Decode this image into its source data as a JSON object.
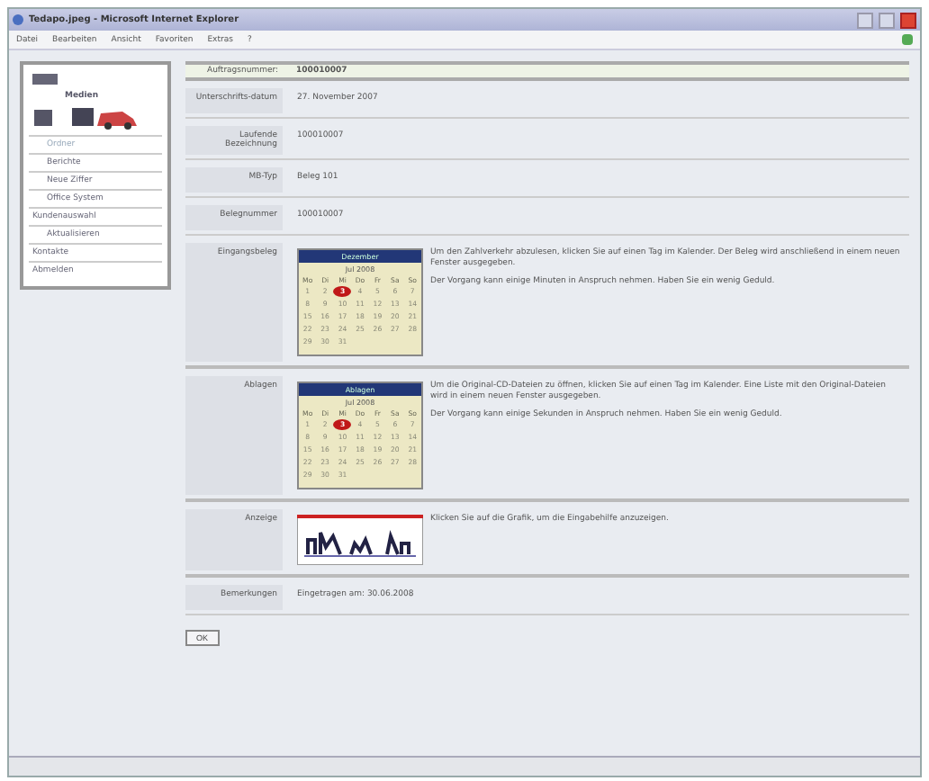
{
  "window": {
    "title": "Tedapo.jpeg - Microsoft Internet Explorer"
  },
  "menu": [
    "Datei",
    "Bearbeiten",
    "Ansicht",
    "Favoriten",
    "Extras",
    "?"
  ],
  "sidebar": {
    "title": "Medien",
    "items": [
      {
        "label": "Ordner",
        "selected": true
      },
      {
        "label": "Berichte",
        "selected": false
      },
      {
        "label": "Neue Ziffer",
        "selected": false
      },
      {
        "label": "Office System",
        "selected": false
      },
      {
        "label": "Kundenauswahl",
        "selected": false,
        "children": [
          {
            "label": "Aktualisieren",
            "selected": false
          }
        ]
      },
      {
        "label": "Kontakte",
        "selected": false
      },
      {
        "label": "Abmelden",
        "selected": false
      }
    ]
  },
  "header": {
    "label": "Auftragsnummer:",
    "value": "100010007"
  },
  "fields": [
    {
      "label": "Unterschrifts-datum",
      "value": "27. November 2007"
    },
    {
      "label": "Laufende Bezeichnung",
      "value": "100010007"
    },
    {
      "label": "MB-Typ",
      "value": "Beleg 101"
    },
    {
      "label": "Belegnummer",
      "value": "100010007"
    }
  ],
  "sections": [
    {
      "label": "Eingangsbeleg",
      "kind": "calendar",
      "calendar": {
        "title": "Dezember",
        "month": "Jul 2008",
        "weekdays": [
          "Mo",
          "Di",
          "Mi",
          "Do",
          "Fr",
          "Sa",
          "So"
        ],
        "days": [
          {
            "d": "1",
            "selected": false
          },
          {
            "d": "2",
            "selected": false
          },
          {
            "d": "3",
            "selected": true
          },
          {
            "d": "4",
            "selected": false
          },
          {
            "d": "5",
            "selected": false
          },
          {
            "d": "6",
            "selected": false
          },
          {
            "d": "7",
            "selected": false
          },
          {
            "d": "8",
            "selected": false
          },
          {
            "d": "9",
            "selected": false
          },
          {
            "d": "10",
            "selected": false
          },
          {
            "d": "11",
            "selected": false
          },
          {
            "d": "12",
            "selected": false
          },
          {
            "d": "13",
            "selected": false
          },
          {
            "d": "14",
            "selected": false
          },
          {
            "d": "15",
            "selected": false
          },
          {
            "d": "16",
            "selected": false
          },
          {
            "d": "17",
            "selected": false
          },
          {
            "d": "18",
            "selected": false
          },
          {
            "d": "19",
            "selected": false
          },
          {
            "d": "20",
            "selected": false
          },
          {
            "d": "21",
            "selected": false
          },
          {
            "d": "22",
            "selected": false
          },
          {
            "d": "23",
            "selected": false
          },
          {
            "d": "24",
            "selected": false
          },
          {
            "d": "25",
            "selected": false
          },
          {
            "d": "26",
            "selected": false
          },
          {
            "d": "27",
            "selected": false
          },
          {
            "d": "28",
            "selected": false
          },
          {
            "d": "29",
            "selected": false
          },
          {
            "d": "30",
            "selected": false
          },
          {
            "d": "31",
            "selected": false
          }
        ]
      },
      "texts": [
        "Um den Zahlverkehr abzulesen, klicken Sie auf einen Tag im Kalender. Der Beleg wird anschließend in einem neuen Fenster ausgegeben.",
        "Der Vorgang kann einige Minuten in Anspruch nehmen. Haben Sie ein wenig Geduld."
      ]
    },
    {
      "label": "Ablagen",
      "kind": "calendar",
      "calendar": {
        "title": "Ablagen",
        "month": "Jul 2008",
        "weekdays": [
          "Mo",
          "Di",
          "Mi",
          "Do",
          "Fr",
          "Sa",
          "So"
        ],
        "days": [
          {
            "d": "1",
            "selected": false
          },
          {
            "d": "2",
            "selected": false
          },
          {
            "d": "3",
            "selected": true
          },
          {
            "d": "4",
            "selected": false
          },
          {
            "d": "5",
            "selected": false
          },
          {
            "d": "6",
            "selected": false
          },
          {
            "d": "7",
            "selected": false
          },
          {
            "d": "8",
            "selected": false
          },
          {
            "d": "9",
            "selected": false
          },
          {
            "d": "10",
            "selected": false
          },
          {
            "d": "11",
            "selected": false
          },
          {
            "d": "12",
            "selected": false
          },
          {
            "d": "13",
            "selected": false
          },
          {
            "d": "14",
            "selected": false
          },
          {
            "d": "15",
            "selected": false
          },
          {
            "d": "16",
            "selected": false
          },
          {
            "d": "17",
            "selected": false
          },
          {
            "d": "18",
            "selected": false
          },
          {
            "d": "19",
            "selected": false
          },
          {
            "d": "20",
            "selected": false
          },
          {
            "d": "21",
            "selected": false
          },
          {
            "d": "22",
            "selected": false
          },
          {
            "d": "23",
            "selected": false
          },
          {
            "d": "24",
            "selected": false
          },
          {
            "d": "25",
            "selected": false
          },
          {
            "d": "26",
            "selected": false
          },
          {
            "d": "27",
            "selected": false
          },
          {
            "d": "28",
            "selected": false
          },
          {
            "d": "29",
            "selected": false
          },
          {
            "d": "30",
            "selected": false
          },
          {
            "d": "31",
            "selected": false
          }
        ]
      },
      "texts": [
        "Um die Original-CD-Dateien zu öffnen, klicken Sie auf einen Tag im Kalender. Eine Liste mit den Original-Dateien wird in einem neuen Fenster ausgegeben.",
        "Der Vorgang kann einige Sekunden in Anspruch nehmen. Haben Sie ein wenig Geduld."
      ]
    },
    {
      "label": "Anzeige",
      "kind": "chart",
      "texts": [
        "Klicken Sie auf die Grafik, um die Eingabehilfe anzuzeigen."
      ]
    }
  ],
  "remarks": {
    "label": "Bemerkungen",
    "value": "Eingetragen am: 30.06.2008"
  },
  "ok_button": "OK"
}
